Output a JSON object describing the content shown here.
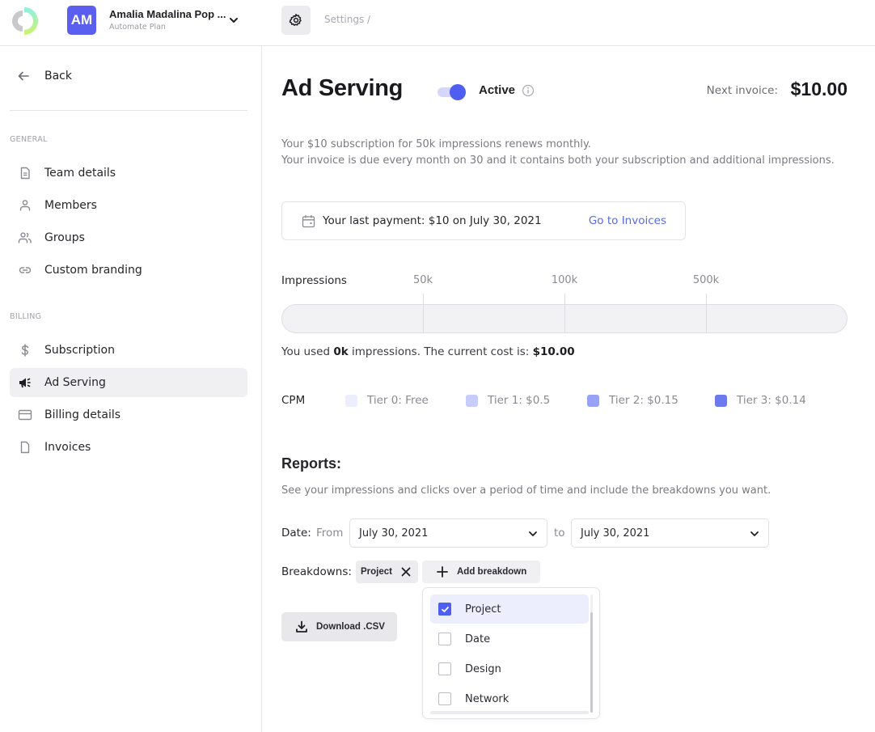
{
  "topbar": {
    "account_initials": "AM",
    "account_name": "Amalia Madalina Pop ...",
    "account_plan": "Automate Plan",
    "breadcrumb": "Settings /",
    "colors": {
      "avatar": "#5b5fef"
    }
  },
  "sidebar": {
    "back_label": "Back",
    "sections": [
      {
        "label": "GENERAL",
        "items": [
          {
            "label": "Team details",
            "icon": "document-icon"
          },
          {
            "label": "Members",
            "icon": "user-icon"
          },
          {
            "label": "Groups",
            "icon": "users-icon"
          },
          {
            "label": "Custom branding",
            "icon": "link-icon"
          }
        ]
      },
      {
        "label": "BILLING",
        "items": [
          {
            "label": "Subscription",
            "icon": "dollar-icon"
          },
          {
            "label": "Ad Serving",
            "icon": "megaphone-icon",
            "active": true
          },
          {
            "label": "Billing details",
            "icon": "credit-card-icon"
          },
          {
            "label": "Invoices",
            "icon": "file-icon"
          }
        ]
      }
    ]
  },
  "main": {
    "title": "Ad Serving",
    "toggle": {
      "on": true,
      "label": "Active"
    },
    "next_invoice_label": "Next invoice:",
    "next_invoice_value": "$10.00",
    "description": [
      "Your $10 subscription for 50k impressions renews monthly.",
      "Your invoice is due every month on 30 and it contains both your subscription and additional impressions."
    ],
    "payment": {
      "text": "Your last payment: $10 on July 30, 2021",
      "link": "Go to Invoices"
    },
    "impressions": {
      "label": "Impressions",
      "ticks": [
        "50k",
        "100k",
        "500k"
      ],
      "used_fraction": 0,
      "usage_prefix": "You used ",
      "usage_amount": "0k",
      "usage_middle": " impressions. The current cost is: ",
      "usage_cost": "$10.00"
    },
    "cpm": {
      "label": "CPM",
      "tiers": [
        {
          "label": "Tier 0: Free",
          "color": "#eceefd"
        },
        {
          "label": "Tier 1: $0.5",
          "color": "#c7ccfa"
        },
        {
          "label": "Tier 2: $0.15",
          "color": "#97a1f5"
        },
        {
          "label": "Tier 3: $0.14",
          "color": "#6d7aef"
        }
      ]
    },
    "reports": {
      "title": "Reports:",
      "description": "See your impressions and clicks over a period of time and include the breakdowns you want.",
      "date_label": "Date:",
      "from_label": "From",
      "from_value": "July 30, 2021",
      "to_label": "to",
      "to_value": "July 30, 2021",
      "breakdowns_label": "Breakdowns:",
      "selected_chip": "Project",
      "add_breakdown_label": "Add breakdown",
      "download_label": "Download .CSV",
      "dropdown_options": [
        {
          "label": "Project",
          "checked": true
        },
        {
          "label": "Date",
          "checked": false
        },
        {
          "label": "Design",
          "checked": false
        },
        {
          "label": "Network",
          "checked": false
        }
      ]
    }
  }
}
